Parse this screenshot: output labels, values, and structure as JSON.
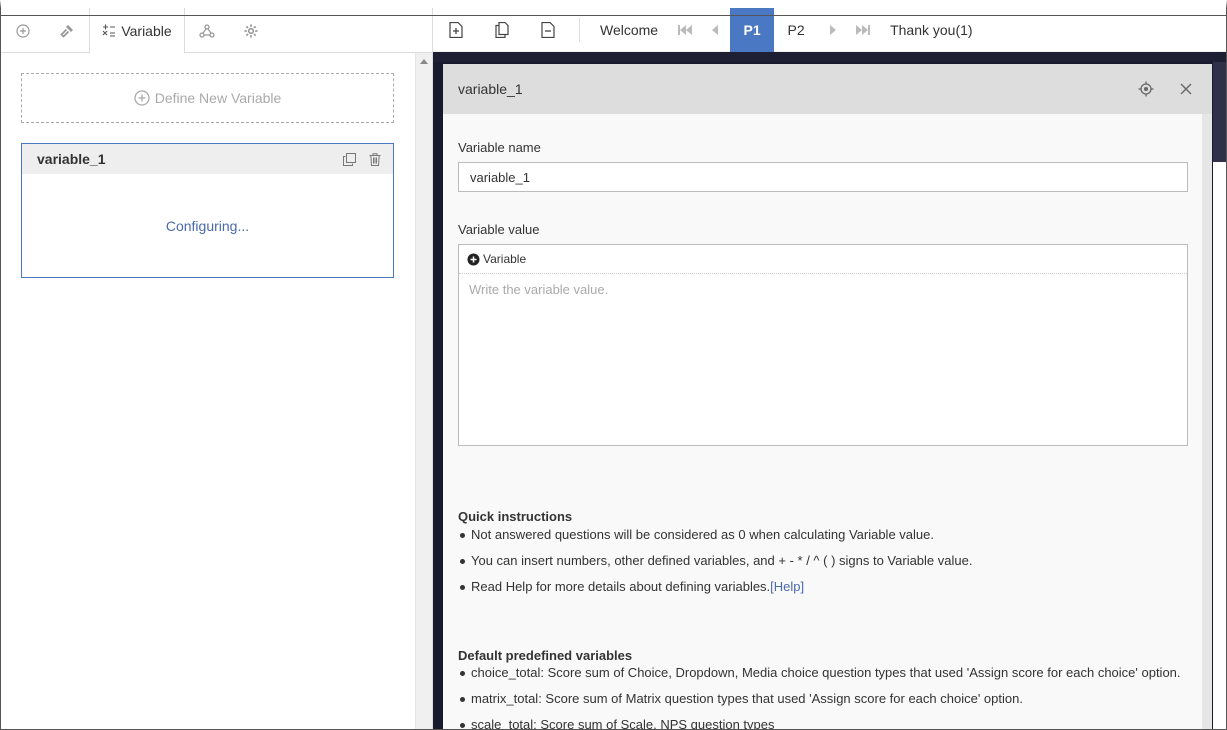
{
  "left_tabs": {
    "variable_label": "Variable"
  },
  "define_button": {
    "label": "Define New Variable"
  },
  "variable_card": {
    "title": "variable_1",
    "status": "Configuring..."
  },
  "toolbar": {
    "pages": [
      {
        "label": "Welcome"
      },
      {
        "label": "P1",
        "active": true
      },
      {
        "label": "P2"
      },
      {
        "label": "Thank you(1)"
      }
    ]
  },
  "dialog": {
    "title": "variable_1",
    "name_label": "Variable name",
    "name_value": "variable_1",
    "value_label": "Variable value",
    "insert_variable_label": "Variable",
    "value_placeholder": "Write the variable value.",
    "quick_title": "Quick instructions",
    "quick_items": [
      "Not answered questions will be considered as 0 when calculating Variable value.",
      "You can insert numbers, other defined variables, and + - * / ^ ( ) signs to Variable value.",
      "Read Help for more details about defining variables."
    ],
    "help_link": "[Help]",
    "default_title": "Default predefined variables",
    "default_items": [
      "choice_total: Score sum of Choice, Dropdown, Media choice question types that used 'Assign score for each choice' option.",
      "matrix_total: Score sum of Matrix question types that used 'Assign score for each choice' option.",
      "scale_total: Score sum of Scale, NPS question types"
    ]
  },
  "colors": {
    "accent": "#4a78c2",
    "link": "#4a6aaa"
  }
}
